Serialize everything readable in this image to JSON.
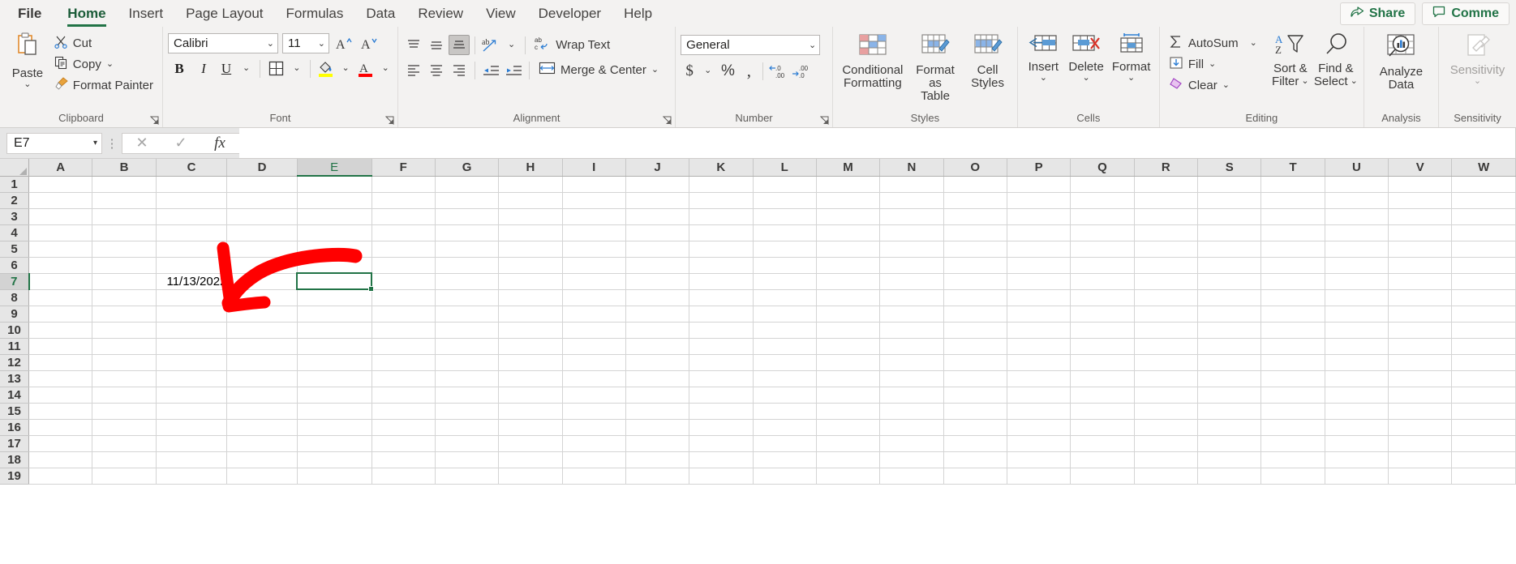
{
  "app": {
    "title": "Microsoft Excel"
  },
  "menubar": {
    "items": [
      {
        "label": "File",
        "active": false
      },
      {
        "label": "Home",
        "active": true
      },
      {
        "label": "Insert",
        "active": false
      },
      {
        "label": "Page Layout",
        "active": false
      },
      {
        "label": "Formulas",
        "active": false
      },
      {
        "label": "Data",
        "active": false
      },
      {
        "label": "Review",
        "active": false
      },
      {
        "label": "View",
        "active": false
      },
      {
        "label": "Developer",
        "active": false
      },
      {
        "label": "Help",
        "active": false
      }
    ],
    "share_label": "Share",
    "comments_label": "Comme",
    "share_icon": "share-icon",
    "comments_icon": "comment-icon"
  },
  "ribbon": {
    "clipboard": {
      "group_label": "Clipboard",
      "paste_label": "Paste",
      "cut_label": "Cut",
      "copy_label": "Copy",
      "format_painter_label": "Format Painter"
    },
    "font": {
      "group_label": "Font",
      "font_name": "Calibri",
      "font_size": "11",
      "bold_label": "B",
      "italic_label": "I",
      "underline_label": "U",
      "grow_font_label": "A",
      "shrink_font_label": "A",
      "borders_icon": "borders-icon",
      "fill_color_icon": "fill-color-icon",
      "font_color_icon": "font-color-icon",
      "fill_color": "#FFFF00",
      "font_color": "#FF0000"
    },
    "alignment": {
      "group_label": "Alignment",
      "top_align_icon": "align-top-icon",
      "middle_align_icon": "align-middle-icon",
      "bottom_align_icon": "align-bottom-icon",
      "orientation_icon": "orientation-icon",
      "wrap_text_label": "Wrap Text",
      "align_left_icon": "align-left-icon",
      "align_center_icon": "align-center-icon",
      "align_right_icon": "align-right-icon",
      "decrease_indent_icon": "decrease-indent-icon",
      "increase_indent_icon": "increase-indent-icon",
      "merge_center_label": "Merge & Center"
    },
    "number": {
      "group_label": "Number",
      "format_value": "General",
      "accounting_icon": "currency-icon",
      "percent_icon": "percent-icon",
      "comma_icon": "comma-icon",
      "increase_decimal_icon": "increase-decimal-icon",
      "decrease_decimal_icon": "decrease-decimal-icon"
    },
    "styles": {
      "group_label": "Styles",
      "conditional_formatting_label": "Conditional",
      "conditional_formatting_label2": "Formatting",
      "format_as_table_label": "Format as",
      "format_as_table_label2": "Table",
      "cell_styles_label": "Cell",
      "cell_styles_label2": "Styles"
    },
    "cells": {
      "group_label": "Cells",
      "insert_label": "Insert",
      "delete_label": "Delete",
      "format_label": "Format"
    },
    "editing": {
      "group_label": "Editing",
      "autosum_label": "AutoSum",
      "fill_label": "Fill",
      "clear_label": "Clear",
      "sort_filter_label": "Sort &",
      "sort_filter_label2": "Filter",
      "find_select_label": "Find &",
      "find_select_label2": "Select"
    },
    "analysis": {
      "group_label": "Analysis",
      "analyze_data_label": "Analyze",
      "analyze_data_label2": "Data"
    },
    "sensitivity": {
      "group_label": "Sensitivity",
      "sensitivity_label": "Sensitivity"
    }
  },
  "formula_bar": {
    "name_box_value": "E7",
    "cancel_icon": "cancel-icon",
    "confirm_icon": "checkmark-icon",
    "function_icon": "fx-icon",
    "formula_value": ""
  },
  "sheet": {
    "columns": [
      "A",
      "B",
      "C",
      "D",
      "E",
      "F",
      "G",
      "H",
      "I",
      "J",
      "K",
      "L",
      "M",
      "N",
      "O",
      "P",
      "Q",
      "R",
      "S",
      "T",
      "U",
      "V",
      "W"
    ],
    "selected_column": "E",
    "rows": [
      1,
      2,
      3,
      4,
      5,
      6,
      7,
      8,
      9,
      10,
      11,
      12,
      13,
      14,
      15,
      16,
      17,
      18,
      19
    ],
    "selected_row": 7,
    "selected_cell": "E7",
    "cells": [
      {
        "ref": "C7",
        "row": 7,
        "col": "C",
        "value": "11/13/2022",
        "align": "right"
      }
    ],
    "annotation": {
      "type": "red-arrow",
      "color": "#FF0000",
      "points_to": "C7"
    }
  }
}
